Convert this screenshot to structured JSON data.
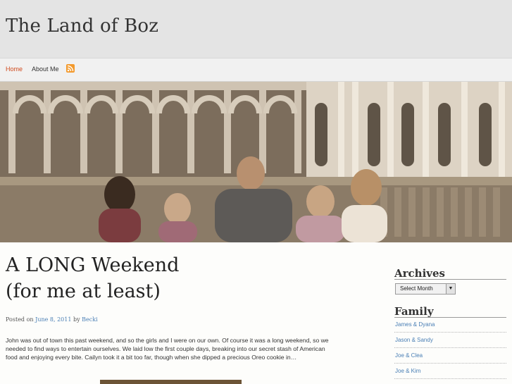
{
  "site": {
    "title": "The Land of Boz"
  },
  "nav": {
    "home": "Home",
    "about": "About Me"
  },
  "post": {
    "title_line1": "A LONG Weekend",
    "title_line2": "(for me at least)",
    "meta": {
      "posted_on": "Posted on",
      "date": "June 8, 2011",
      "by": "by",
      "author": "Becki"
    },
    "excerpt": "John was out of town this past weekend, and so the girls and I were on our own. Of course it was a long weekend, so we needed to find ways to entertain ourselves. We laid low the first couple days, breaking into our secret stash of American food and enjoying every bite. Cailyn took it a bit too far, though when she dipped a precious Oreo cookie in…"
  },
  "sidebar": {
    "archives": {
      "title": "Archives",
      "select_value": "Select Month"
    },
    "family": {
      "title": "Family",
      "links": [
        "James & Dyana",
        "Jason & Sandy",
        "Joe & Clea",
        "Joe & Kim"
      ]
    }
  },
  "colors": {
    "accent_nav": "#d04a1c",
    "link": "#4a7fb5",
    "header_bg": "#e4e4e4"
  },
  "icons": {
    "rss": "rss-icon",
    "dropdown": "chevron-down-icon"
  }
}
